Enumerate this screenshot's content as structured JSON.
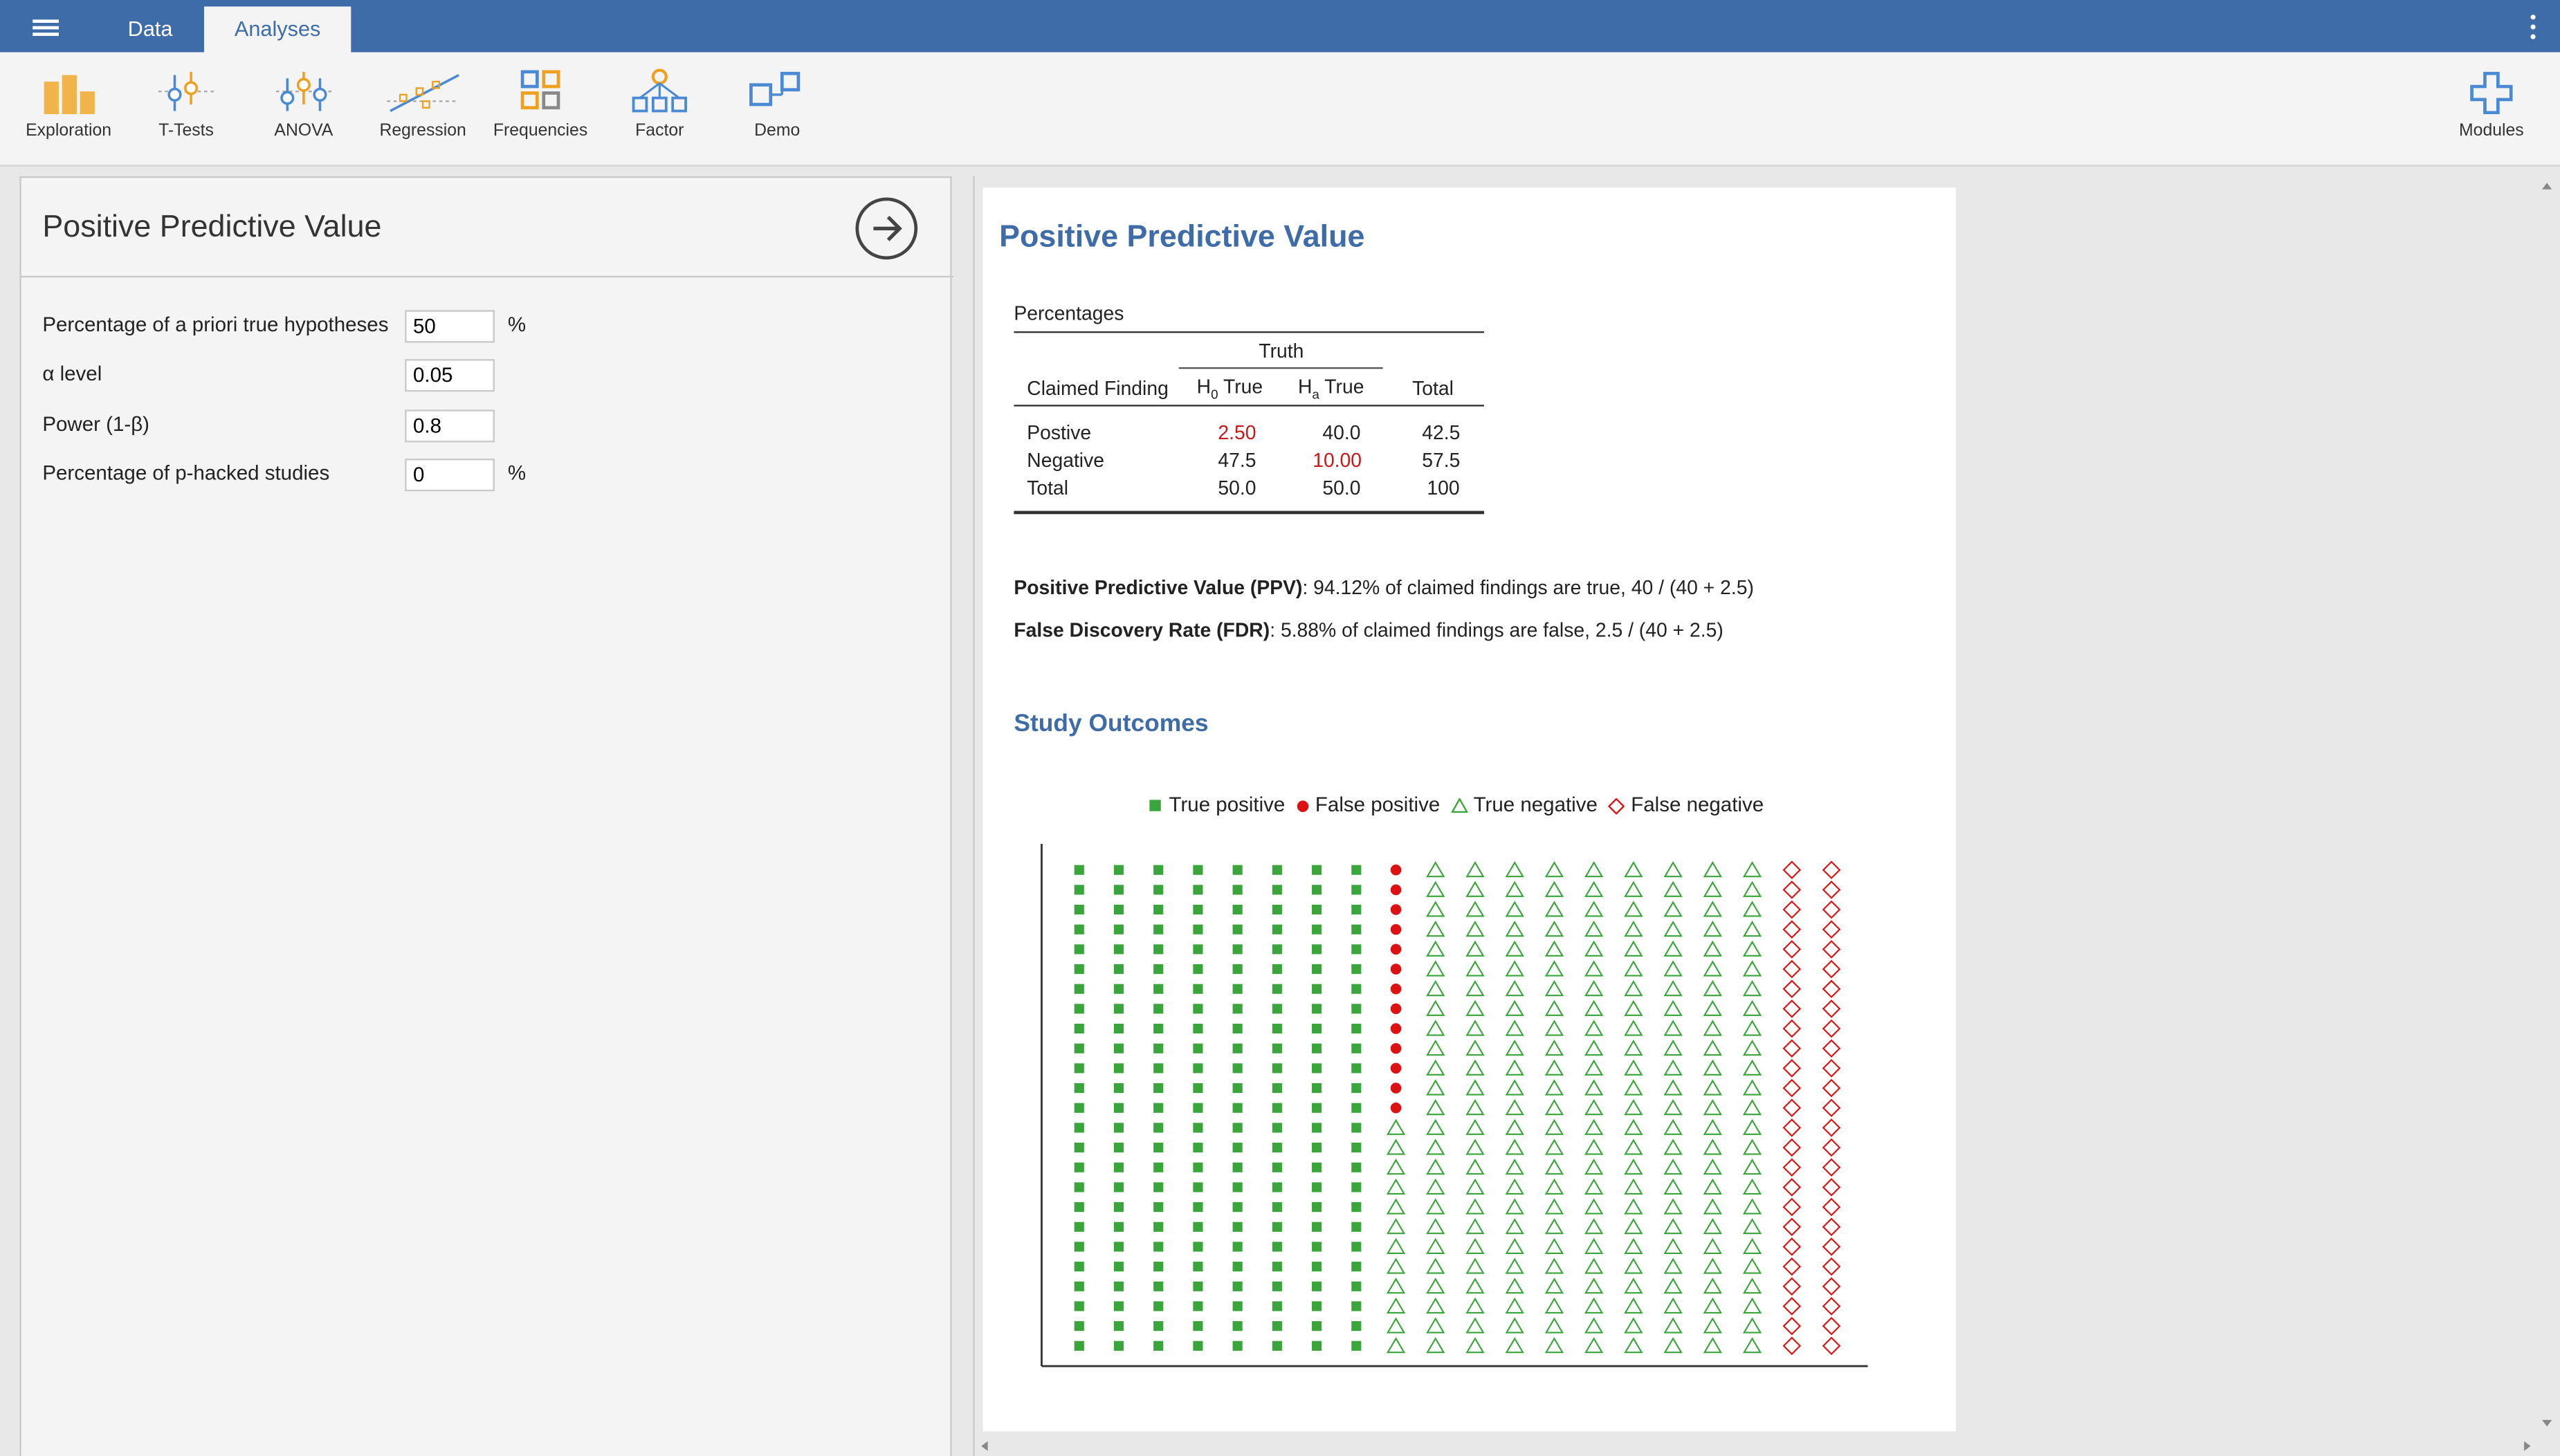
{
  "topbar": {
    "tabs": [
      "Data",
      "Analyses"
    ],
    "active_tab": "Analyses"
  },
  "ribbon": {
    "items": [
      {
        "label": "Exploration",
        "icon": "exploration-icon"
      },
      {
        "label": "T-Tests",
        "icon": "t-tests-icon"
      },
      {
        "label": "ANOVA",
        "icon": "anova-icon"
      },
      {
        "label": "Regression",
        "icon": "regression-icon"
      },
      {
        "label": "Frequencies",
        "icon": "frequencies-icon"
      },
      {
        "label": "Factor",
        "icon": "factor-icon"
      },
      {
        "label": "Demo",
        "icon": "demo-icon"
      }
    ],
    "modules_label": "Modules"
  },
  "options": {
    "title": "Positive Predictive Value",
    "fields": [
      {
        "label": "Percentage of a priori true hypotheses",
        "value": "50",
        "unit": "%"
      },
      {
        "label": "α level",
        "value": "0.05",
        "unit": ""
      },
      {
        "label": "Power (1-β)",
        "value": "0.8",
        "unit": ""
      },
      {
        "label": "Percentage of p-hacked studies",
        "value": "0",
        "unit": "%"
      }
    ]
  },
  "results": {
    "title": "Positive Predictive Value",
    "table": {
      "title": "Percentages",
      "group_header": "Truth",
      "col_claimed": "Claimed Finding",
      "col_h0_prefix": "H",
      "col_h0_sub": "0",
      "col_h0_suffix": " True",
      "col_ha_prefix": "H",
      "col_ha_sub": "a",
      "col_ha_suffix": " True",
      "col_total": "Total",
      "rows": [
        {
          "label": "Postive",
          "h0": "2.50",
          "ha": "40.0",
          "total": "42.5"
        },
        {
          "label": "Negative",
          "h0": "47.5",
          "ha": "10.00",
          "total": "57.5"
        },
        {
          "label": "Total",
          "h0": "50.0",
          "ha": "50.0",
          "total": "100"
        }
      ]
    },
    "ppv": {
      "label": "Positive Predictive Value (PPV)",
      "text": ": 94.12% of claimed findings are true, 40 / (40 + 2.5)"
    },
    "fdr": {
      "label": "False Discovery Rate (FDR)",
      "text": ": 5.88% of claimed findings are false, 2.5 / (40 + 2.5)"
    },
    "outcomes_title": "Study Outcomes"
  },
  "chart_data": {
    "type": "scatter",
    "title": "",
    "legend": [
      "True positive",
      "False positive",
      "True negative",
      "False negative"
    ],
    "legend_placement": "top",
    "colors": {
      "true_positive": "#3aa53a",
      "false_positive": "#dd1111",
      "true_negative": "#3aa53a",
      "false_negative": "#dd1111"
    },
    "grid": {
      "columns": 20,
      "rows": 25
    },
    "counts": {
      "true_positive": 200,
      "false_positive": 13,
      "true_negative": 237,
      "false_negative": 50
    },
    "columns": [
      "tp",
      "tp",
      "tp",
      "tp",
      "tp",
      "tp",
      "tp",
      "tp",
      {
        "fp": 13,
        "tn": 12
      },
      "tn",
      "tn",
      "tn",
      "tn",
      "tn",
      "tn",
      "tn",
      "tn",
      "tn",
      "fn",
      "fn"
    ]
  }
}
